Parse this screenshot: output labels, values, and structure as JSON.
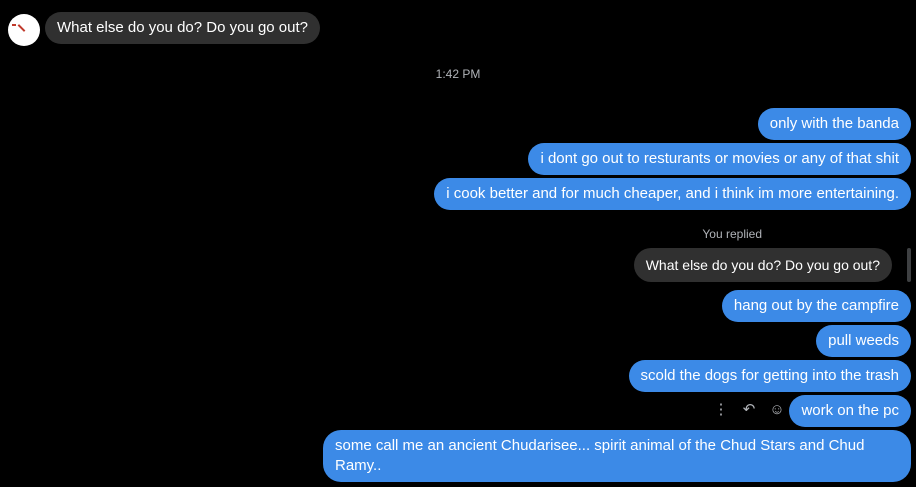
{
  "conversation": {
    "incoming_first": "What else do you do? Do you go out?",
    "timestamp": "1:42 PM",
    "outgoing_batch1": [
      "only with the banda",
      "i dont go out to resturants or movies or any of that shit",
      "i cook better and for much cheaper, and i think im more entertaining."
    ],
    "replied_label": "You replied",
    "reply_quote": "What else do you do? Do you go out?",
    "outgoing_batch2": [
      "hang out by the campfire",
      "pull weeds",
      "scold the dogs for getting into the trash",
      "work on the pc",
      "some call me an ancient Chudarisee... spirit animal of the Chud Stars and Chud Ramy.."
    ]
  },
  "message_actions": {
    "more_icon": "⋮",
    "reply_icon": "↶",
    "react_icon": "☺"
  },
  "colors": {
    "background": "#000000",
    "incoming_bubble": "#303030",
    "outgoing_bubble": "#3c8ae7",
    "meta_text": "#b0b3b8"
  }
}
